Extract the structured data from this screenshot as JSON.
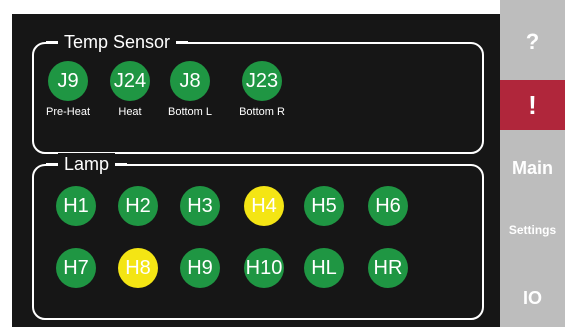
{
  "temp_sensor": {
    "title": "Temp Sensor",
    "sensors": [
      {
        "id": "J9",
        "label": "Pre-Heat"
      },
      {
        "id": "J24",
        "label": "Heat"
      },
      {
        "id": "J8",
        "label": "Bottom L"
      },
      {
        "id": "J23",
        "label": "Bottom R"
      }
    ]
  },
  "lamp": {
    "title": "Lamp",
    "lamps": [
      {
        "id": "H1",
        "on": false
      },
      {
        "id": "H2",
        "on": false
      },
      {
        "id": "H3",
        "on": false
      },
      {
        "id": "H4",
        "on": true
      },
      {
        "id": "H5",
        "on": false
      },
      {
        "id": "H6",
        "on": false
      },
      {
        "id": "H7",
        "on": false
      },
      {
        "id": "H8",
        "on": true
      },
      {
        "id": "H9",
        "on": false
      },
      {
        "id": "H10",
        "on": false
      },
      {
        "id": "HL",
        "on": false
      },
      {
        "id": "HR",
        "on": false
      }
    ]
  },
  "sidebar": {
    "help": "?",
    "alert": "!",
    "main": "Main",
    "settings": "Settings",
    "io": "IO"
  },
  "colors": {
    "off": "#1f9643",
    "on": "#f4e514",
    "alert": "#b0263b",
    "sidebar": "#bdbdbd",
    "screen": "#161616"
  }
}
